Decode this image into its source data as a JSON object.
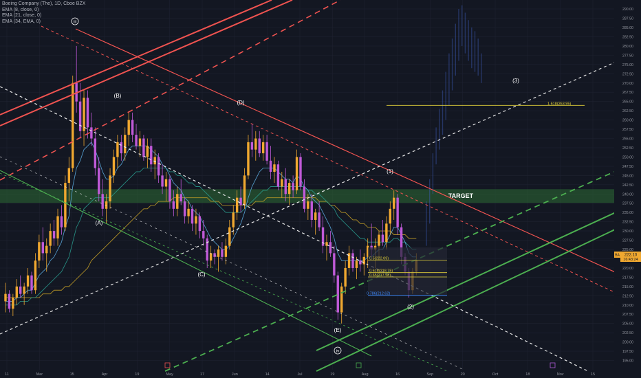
{
  "header": {
    "title": "Boeing Company (The), 1D, Cboe BZX",
    "indicators": [
      "EMA (8, close, 0)",
      "EMA (21, close, 0)",
      "EMA (34, EMA, 0)"
    ]
  },
  "price_badges": {
    "current": "222.10",
    "countdown": "16:43:24",
    "ticker": "BA"
  },
  "colors": {
    "background": "#131722",
    "bull": "#f0a830",
    "bear": "#c05ad8",
    "red_channel": "#ef5350",
    "green_channel": "#4caf50",
    "white_line": "#e8e8e8",
    "target_zone": "#2e6b35",
    "fib_yellow": "#e5d43a",
    "fib_blue": "#3d8bfd"
  },
  "chart_data": {
    "type": "candlestick",
    "y_axis_side": "right",
    "ylim": [
      192.5,
      291.5
    ],
    "y_ticks": [
      195.0,
      197.5,
      200.0,
      202.5,
      205.0,
      207.5,
      210.0,
      212.5,
      215.0,
      217.5,
      220.0,
      222.5,
      225.0,
      227.5,
      230.0,
      232.5,
      235.0,
      237.5,
      240.0,
      242.5,
      245.0,
      247.5,
      250.0,
      252.5,
      255.0,
      257.5,
      260.0,
      262.5,
      265.0,
      267.5,
      270.0,
      272.5,
      275.0,
      277.5,
      280.0,
      282.5,
      285.0,
      287.5,
      290.0
    ],
    "x_ticks": [
      "11",
      "Mar",
      "15",
      "Apr",
      "19",
      "May",
      "17",
      "Jun",
      "14",
      "Jul",
      "19",
      "Aug",
      "16",
      "Sep",
      "20",
      "Oct",
      "18",
      "Nov",
      "15"
    ],
    "target_zone": {
      "label": "TARGET",
      "low": 237.6,
      "high": 241.3
    },
    "wave_labels": [
      "iii",
      "(A)",
      "(B)",
      "(C)",
      "(D)",
      "(E)",
      "iv",
      "(1)",
      "(2)",
      "(3)"
    ],
    "fib_levels": [
      {
        "label": "0.5(222.09)",
        "value": 222.1
      },
      {
        "label": "0.618(218.75)",
        "value": 218.75
      },
      {
        "label": "0.65(217.58)",
        "value": 217.58
      },
      {
        "label": "0.786(212.62)",
        "value": 212.62
      },
      {
        "label": "1.618(263.95)",
        "value": 263.95
      }
    ],
    "candles": [
      {
        "o": 211,
        "h": 216,
        "l": 208,
        "c": 213
      },
      {
        "o": 213,
        "h": 214,
        "l": 208,
        "c": 209
      },
      {
        "o": 209,
        "h": 213,
        "l": 207,
        "c": 212
      },
      {
        "o": 212,
        "h": 217,
        "l": 210,
        "c": 215
      },
      {
        "o": 215,
        "h": 218,
        "l": 212,
        "c": 213
      },
      {
        "o": 213,
        "h": 216,
        "l": 210,
        "c": 215
      },
      {
        "o": 215,
        "h": 220,
        "l": 213,
        "c": 218
      },
      {
        "o": 218,
        "h": 219,
        "l": 213,
        "c": 214
      },
      {
        "o": 214,
        "h": 224,
        "l": 213,
        "c": 222
      },
      {
        "o": 222,
        "h": 229,
        "l": 220,
        "c": 227
      },
      {
        "o": 227,
        "h": 231,
        "l": 222,
        "c": 224
      },
      {
        "o": 224,
        "h": 228,
        "l": 219,
        "c": 226
      },
      {
        "o": 226,
        "h": 232,
        "l": 224,
        "c": 230
      },
      {
        "o": 230,
        "h": 233,
        "l": 226,
        "c": 228
      },
      {
        "o": 228,
        "h": 236,
        "l": 226,
        "c": 234
      },
      {
        "o": 234,
        "h": 237,
        "l": 229,
        "c": 231
      },
      {
        "o": 231,
        "h": 245,
        "l": 230,
        "c": 243
      },
      {
        "o": 243,
        "h": 250,
        "l": 238,
        "c": 247
      },
      {
        "o": 247,
        "h": 272,
        "l": 246,
        "c": 270
      },
      {
        "o": 270,
        "h": 280,
        "l": 262,
        "c": 265
      },
      {
        "o": 265,
        "h": 270,
        "l": 255,
        "c": 257
      },
      {
        "o": 257,
        "h": 268,
        "l": 253,
        "c": 266
      },
      {
        "o": 266,
        "h": 268,
        "l": 255,
        "c": 258
      },
      {
        "o": 258,
        "h": 262,
        "l": 253,
        "c": 255
      },
      {
        "o": 255,
        "h": 258,
        "l": 245,
        "c": 247
      },
      {
        "o": 247,
        "h": 250,
        "l": 238,
        "c": 240
      },
      {
        "o": 240,
        "h": 244,
        "l": 234,
        "c": 236
      },
      {
        "o": 236,
        "h": 240,
        "l": 232,
        "c": 238
      },
      {
        "o": 238,
        "h": 247,
        "l": 236,
        "c": 245
      },
      {
        "o": 245,
        "h": 252,
        "l": 243,
        "c": 250
      },
      {
        "o": 250,
        "h": 256,
        "l": 247,
        "c": 254
      },
      {
        "o": 254,
        "h": 256,
        "l": 249,
        "c": 251
      },
      {
        "o": 251,
        "h": 258,
        "l": 249,
        "c": 256
      },
      {
        "o": 256,
        "h": 262,
        "l": 253,
        "c": 260
      },
      {
        "o": 260,
        "h": 262,
        "l": 254,
        "c": 256
      },
      {
        "o": 256,
        "h": 259,
        "l": 252,
        "c": 253
      },
      {
        "o": 253,
        "h": 257,
        "l": 250,
        "c": 255
      },
      {
        "o": 255,
        "h": 256,
        "l": 249,
        "c": 250
      },
      {
        "o": 250,
        "h": 255,
        "l": 247,
        "c": 253
      },
      {
        "o": 253,
        "h": 255,
        "l": 246,
        "c": 248
      },
      {
        "o": 248,
        "h": 252,
        "l": 244,
        "c": 250
      },
      {
        "o": 250,
        "h": 251,
        "l": 243,
        "c": 245
      },
      {
        "o": 245,
        "h": 248,
        "l": 240,
        "c": 242
      },
      {
        "o": 242,
        "h": 246,
        "l": 238,
        "c": 244
      },
      {
        "o": 244,
        "h": 245,
        "l": 236,
        "c": 238
      },
      {
        "o": 238,
        "h": 241,
        "l": 234,
        "c": 236
      },
      {
        "o": 236,
        "h": 242,
        "l": 234,
        "c": 240
      },
      {
        "o": 240,
        "h": 244,
        "l": 237,
        "c": 238
      },
      {
        "o": 238,
        "h": 239,
        "l": 232,
        "c": 234
      },
      {
        "o": 234,
        "h": 238,
        "l": 232,
        "c": 236
      },
      {
        "o": 236,
        "h": 237,
        "l": 230,
        "c": 232
      },
      {
        "o": 232,
        "h": 236,
        "l": 229,
        "c": 234
      },
      {
        "o": 234,
        "h": 235,
        "l": 228,
        "c": 230
      },
      {
        "o": 230,
        "h": 233,
        "l": 226,
        "c": 228
      },
      {
        "o": 228,
        "h": 229,
        "l": 220,
        "c": 222
      },
      {
        "o": 222,
        "h": 226,
        "l": 220,
        "c": 224
      },
      {
        "o": 224,
        "h": 225,
        "l": 221,
        "c": 223
      },
      {
        "o": 223,
        "h": 226,
        "l": 219,
        "c": 225
      },
      {
        "o": 225,
        "h": 227,
        "l": 222,
        "c": 223
      },
      {
        "o": 223,
        "h": 228,
        "l": 221,
        "c": 226
      },
      {
        "o": 226,
        "h": 233,
        "l": 225,
        "c": 231
      },
      {
        "o": 231,
        "h": 237,
        "l": 229,
        "c": 235
      },
      {
        "o": 235,
        "h": 241,
        "l": 233,
        "c": 239
      },
      {
        "o": 239,
        "h": 242,
        "l": 235,
        "c": 237
      },
      {
        "o": 237,
        "h": 247,
        "l": 236,
        "c": 245
      },
      {
        "o": 245,
        "h": 256,
        "l": 244,
        "c": 254
      },
      {
        "o": 254,
        "h": 259,
        "l": 250,
        "c": 252
      },
      {
        "o": 252,
        "h": 257,
        "l": 249,
        "c": 255
      },
      {
        "o": 255,
        "h": 257,
        "l": 250,
        "c": 251
      },
      {
        "o": 251,
        "h": 256,
        "l": 249,
        "c": 254
      },
      {
        "o": 254,
        "h": 256,
        "l": 248,
        "c": 249
      },
      {
        "o": 249,
        "h": 253,
        "l": 244,
        "c": 246
      },
      {
        "o": 246,
        "h": 250,
        "l": 243,
        "c": 248
      },
      {
        "o": 248,
        "h": 249,
        "l": 241,
        "c": 242
      },
      {
        "o": 242,
        "h": 246,
        "l": 239,
        "c": 244
      },
      {
        "o": 244,
        "h": 247,
        "l": 238,
        "c": 240
      },
      {
        "o": 240,
        "h": 244,
        "l": 237,
        "c": 243
      },
      {
        "o": 243,
        "h": 245,
        "l": 239,
        "c": 241
      },
      {
        "o": 241,
        "h": 252,
        "l": 240,
        "c": 250
      },
      {
        "o": 250,
        "h": 251,
        "l": 241,
        "c": 242
      },
      {
        "o": 242,
        "h": 244,
        "l": 235,
        "c": 236
      },
      {
        "o": 236,
        "h": 240,
        "l": 233,
        "c": 238
      },
      {
        "o": 238,
        "h": 240,
        "l": 231,
        "c": 233
      },
      {
        "o": 233,
        "h": 236,
        "l": 229,
        "c": 235
      },
      {
        "o": 235,
        "h": 238,
        "l": 230,
        "c": 231
      },
      {
        "o": 231,
        "h": 234,
        "l": 224,
        "c": 226
      },
      {
        "o": 226,
        "h": 229,
        "l": 222,
        "c": 227
      },
      {
        "o": 227,
        "h": 230,
        "l": 223,
        "c": 224
      },
      {
        "o": 224,
        "h": 226,
        "l": 216,
        "c": 218
      },
      {
        "o": 218,
        "h": 219,
        "l": 206,
        "c": 208
      },
      {
        "o": 208,
        "h": 216,
        "l": 205,
        "c": 215
      },
      {
        "o": 215,
        "h": 222,
        "l": 213,
        "c": 220
      },
      {
        "o": 220,
        "h": 226,
        "l": 218,
        "c": 224
      },
      {
        "o": 224,
        "h": 225,
        "l": 219,
        "c": 220
      },
      {
        "o": 220,
        "h": 223,
        "l": 217,
        "c": 222
      },
      {
        "o": 222,
        "h": 225,
        "l": 219,
        "c": 221
      },
      {
        "o": 221,
        "h": 224,
        "l": 218,
        "c": 223
      },
      {
        "o": 223,
        "h": 228,
        "l": 220,
        "c": 226
      },
      {
        "o": 226,
        "h": 232,
        "l": 223,
        "c": 225
      },
      {
        "o": 225,
        "h": 228,
        "l": 220,
        "c": 226
      },
      {
        "o": 226,
        "h": 230,
        "l": 222,
        "c": 229
      },
      {
        "o": 229,
        "h": 233,
        "l": 226,
        "c": 227
      },
      {
        "o": 227,
        "h": 234,
        "l": 225,
        "c": 232
      },
      {
        "o": 232,
        "h": 238,
        "l": 229,
        "c": 236
      },
      {
        "o": 236,
        "h": 241,
        "l": 233,
        "c": 239
      },
      {
        "o": 239,
        "h": 240,
        "l": 229,
        "c": 231
      },
      {
        "o": 231,
        "h": 232,
        "l": 221,
        "c": 223
      },
      {
        "o": 223,
        "h": 224,
        "l": 218,
        "c": 219
      },
      {
        "o": 219,
        "h": 220,
        "l": 212,
        "c": 214
      },
      {
        "o": 214,
        "h": 220,
        "l": 213,
        "c": 219
      },
      {
        "o": 219,
        "h": 224,
        "l": 218,
        "c": 222
      }
    ],
    "ema_fast": [
      211,
      211,
      211,
      212,
      212,
      213,
      214,
      214,
      216,
      218,
      219,
      220,
      222,
      223,
      225,
      227,
      231,
      234,
      242,
      247,
      249,
      252,
      253,
      254,
      252,
      249,
      246,
      244,
      244,
      245,
      247,
      248,
      250,
      252,
      253,
      253,
      253,
      253,
      253,
      252,
      251,
      250,
      248,
      247,
      245,
      243,
      242,
      241,
      239,
      238,
      236,
      235,
      234,
      232,
      230,
      228,
      227,
      226,
      225,
      225,
      226,
      228,
      230,
      232,
      235,
      239,
      242,
      244,
      246,
      247,
      247,
      247,
      247,
      246,
      245,
      244,
      244,
      243,
      245,
      244,
      242,
      241,
      239,
      238,
      237,
      235,
      233,
      231,
      228,
      224,
      222,
      222,
      222,
      222,
      222,
      222,
      222,
      223,
      223,
      224,
      225,
      225,
      227,
      229,
      231,
      231,
      229,
      227,
      224,
      223,
      223
    ],
    "ema_mid": [
      210,
      210,
      210,
      210,
      211,
      211,
      211,
      212,
      212,
      213,
      214,
      215,
      216,
      217,
      218,
      219,
      221,
      223,
      227,
      231,
      233,
      236,
      237,
      238,
      239,
      239,
      239,
      239,
      239,
      240,
      241,
      242,
      243,
      244,
      245,
      246,
      246,
      247,
      247,
      247,
      247,
      247,
      247,
      247,
      246,
      246,
      245,
      245,
      244,
      243,
      243,
      242,
      242,
      241,
      240,
      239,
      238,
      237,
      236,
      235,
      235,
      235,
      235,
      235,
      236,
      237,
      238,
      239,
      240,
      241,
      241,
      242,
      242,
      242,
      242,
      242,
      242,
      242,
      242,
      242,
      242,
      241,
      241,
      240,
      240,
      239,
      238,
      237,
      236,
      234,
      233,
      232,
      231,
      230,
      229,
      228,
      228,
      227,
      227,
      227,
      227,
      227,
      227,
      227,
      228,
      228,
      227,
      227,
      226,
      225,
      225
    ],
    "ema_slow": [
      212,
      212,
      212,
      212,
      212,
      212,
      212,
      212,
      212,
      212,
      213,
      213,
      213,
      214,
      214,
      214,
      215,
      215,
      216,
      217,
      218,
      219,
      220,
      222,
      223,
      224,
      225,
      226,
      227,
      228,
      229,
      230,
      231,
      232,
      233,
      234,
      235,
      236,
      236,
      237,
      237,
      238,
      238,
      238,
      238,
      239,
      239,
      239,
      239,
      239,
      239,
      239,
      239,
      239,
      239,
      238,
      238,
      238,
      237,
      237,
      237,
      237,
      237,
      237,
      237,
      237,
      237,
      238,
      238,
      238,
      239,
      239,
      239,
      239,
      239,
      239,
      239,
      239,
      239,
      239,
      239,
      239,
      239,
      239,
      238,
      238,
      238,
      237,
      237,
      236,
      235,
      235,
      234,
      233,
      233,
      232,
      232,
      231,
      231,
      231,
      230,
      230,
      230,
      230,
      229,
      229,
      229,
      229,
      228,
      228,
      228
    ],
    "projection_candles": [
      {
        "h": 238,
        "l": 226
      },
      {
        "h": 244,
        "l": 232
      },
      {
        "h": 251,
        "l": 240
      },
      {
        "h": 258,
        "l": 248
      },
      {
        "h": 263,
        "l": 252
      },
      {
        "h": 268,
        "l": 256
      },
      {
        "h": 273,
        "l": 260
      },
      {
        "h": 278,
        "l": 264
      },
      {
        "h": 282,
        "l": 268
      },
      {
        "h": 286,
        "l": 272
      },
      {
        "h": 290,
        "l": 276
      },
      {
        "h": 291,
        "l": 280
      },
      {
        "h": 289,
        "l": 278
      },
      {
        "h": 287,
        "l": 276
      },
      {
        "h": 285,
        "l": 274
      },
      {
        "h": 284,
        "l": 273
      },
      {
        "h": 282,
        "l": 272
      },
      {
        "h": 278,
        "l": 270
      }
    ]
  }
}
